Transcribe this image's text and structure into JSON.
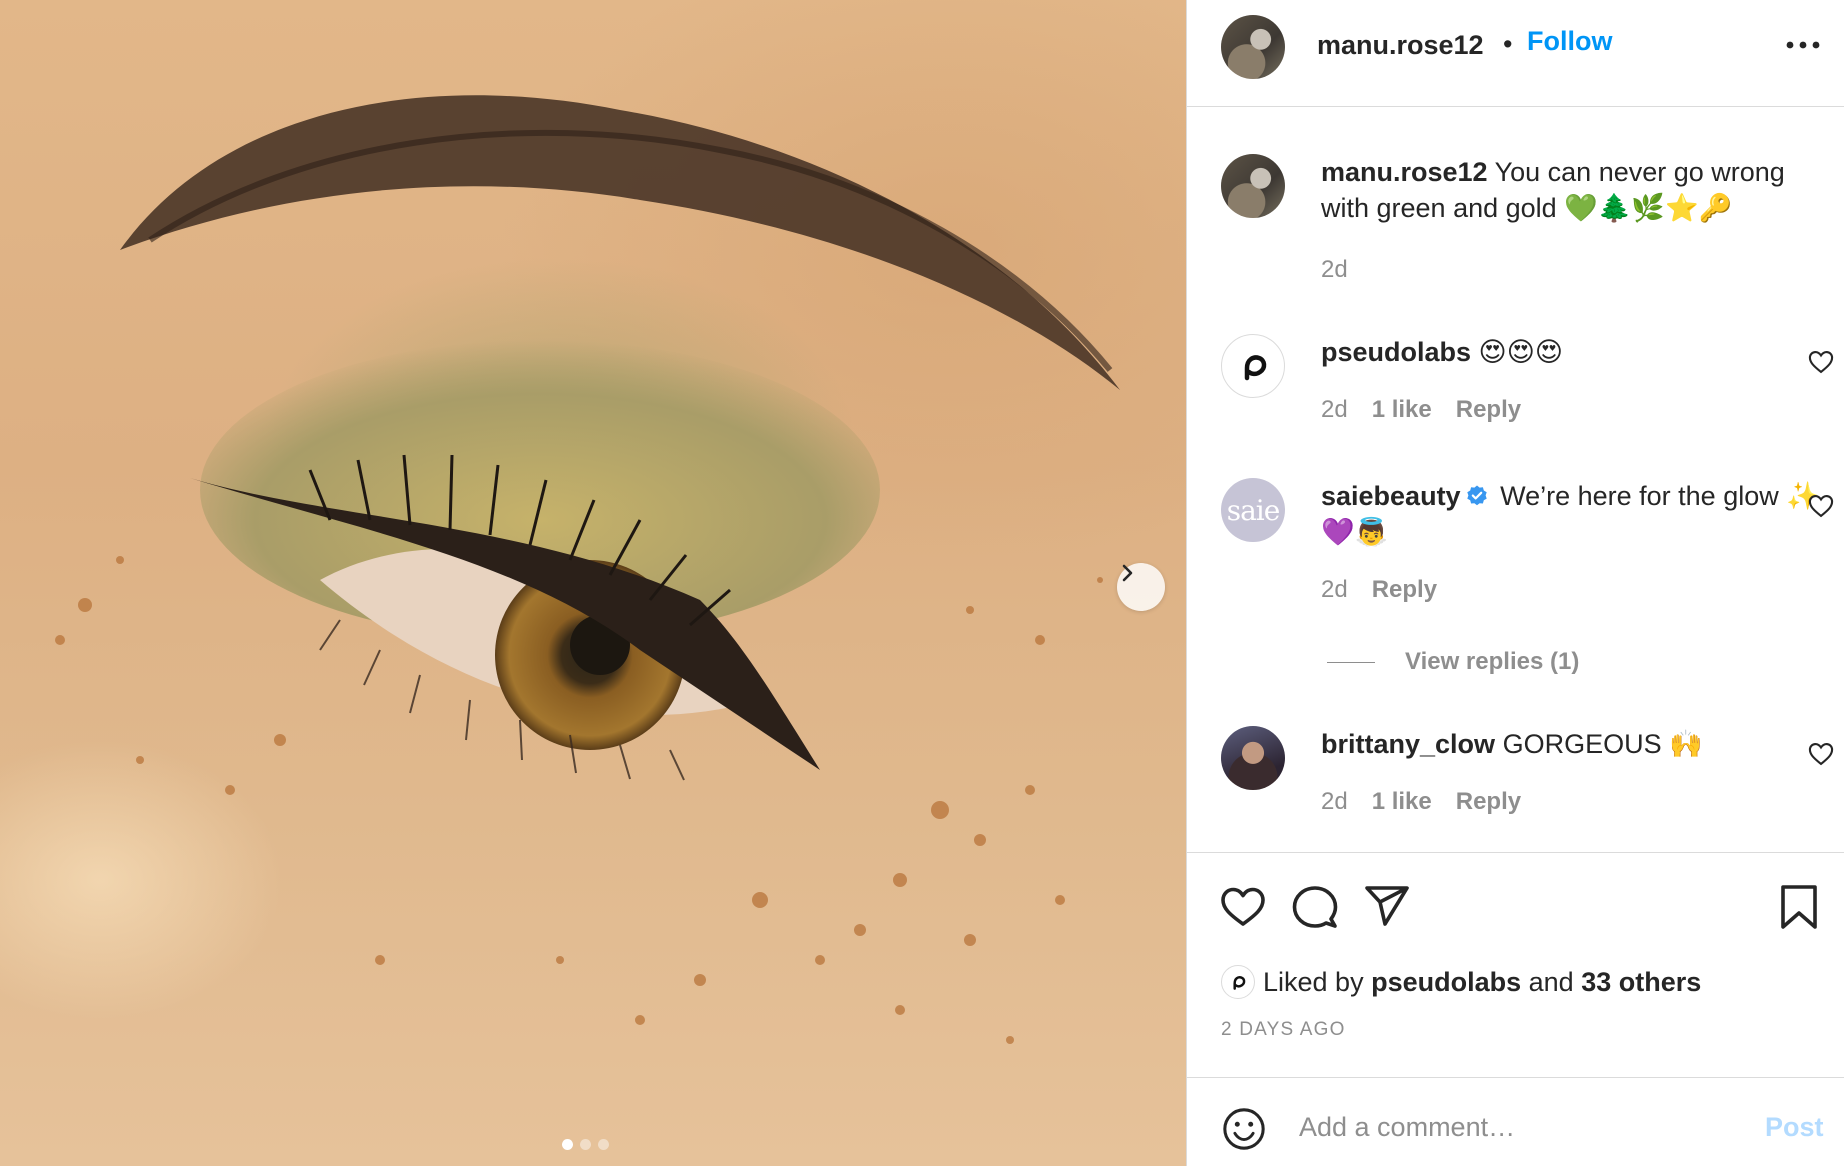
{
  "post": {
    "author": "manu.rose12",
    "separator": "•",
    "follow_label": "Follow",
    "more_icon": "more-horizontal-icon",
    "photo": {
      "carousel_count": 3,
      "active_index": 0
    }
  },
  "caption": {
    "username": "manu.rose12",
    "text": "You can never go wrong with green and gold 💚🌲🌿⭐🔑",
    "time": "2d"
  },
  "comments": [
    {
      "username": "pseudolabs",
      "text": "😍😍😍",
      "time": "2d",
      "likes": "1 like",
      "reply": "Reply",
      "verified": false
    },
    {
      "username": "saiebeauty",
      "text": "We’re here for the glow ✨💜👼",
      "time": "2d",
      "likes": "",
      "reply": "Reply",
      "verified": true,
      "avatar_text": "saie",
      "view_replies": "View replies (1)"
    },
    {
      "username": "brittany_clow",
      "text": "GORGEOUS 🙌",
      "time": "2d",
      "likes": "1 like",
      "reply": "Reply",
      "verified": false
    }
  ],
  "actions": {
    "liked_prefix": "Liked by",
    "liked_user": "pseudolabs",
    "liked_and": "and",
    "liked_others": "33 others",
    "timestamp": "2 DAYS AGO"
  },
  "comment_box": {
    "placeholder": "Add a comment…",
    "post_label": "Post"
  },
  "colors": {
    "link": "#0095f6",
    "muted": "#8e8e8e",
    "text": "#262626",
    "post_disabled": "#b3dbff",
    "verified": "#3897f0"
  }
}
